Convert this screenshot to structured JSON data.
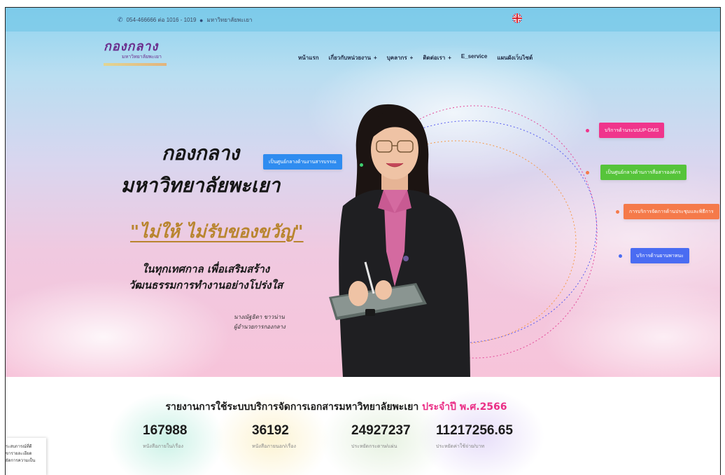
{
  "topbar": {
    "phone": "054-466666 ต่อ 1016 - 1019",
    "location": "มหาวิทยาลัยพะเยา"
  },
  "logo": {
    "title": "กองกลาง",
    "subtitle": "มหาวิทยาลัยพะเยา"
  },
  "nav": {
    "items": [
      {
        "label": "หน้าแรก",
        "plus": ""
      },
      {
        "label": "เกี่ยวกับหน่วยงาน",
        "plus": "+"
      },
      {
        "label": "บุคลากร",
        "plus": "+"
      },
      {
        "label": "ติดต่อเรา",
        "plus": "+"
      },
      {
        "label": "E_service",
        "plus": ""
      },
      {
        "label": "แผนผังเว็บไซต์",
        "plus": ""
      }
    ]
  },
  "hero": {
    "line1": "กองกลาง",
    "line2": "มหาวิทยาลัยพะเยา",
    "slogan": "\"ไม่ให้ ไม่รับของขวัญ\"",
    "sub1": "ในทุกเทศกาล เพื่อเสริมสร้าง",
    "sub2": "วัฒนธรรมการทำงานอย่างโปร่งใส",
    "sign_name": "นางณัฐธิดา ขาวน่าน",
    "sign_title": "ผู้อำนวยการกองกลาง"
  },
  "services": [
    {
      "label": "เป็นศูนย์กลางด้านงานสารบรรณ",
      "color": "#2f8cf0"
    },
    {
      "label": "บริการด้านระบบUP-DMS",
      "color": "#f0358c"
    },
    {
      "label": "เป็นศูนย์กลางด้านการสื่อสารองค์กร",
      "color": "#56c43a"
    },
    {
      "label": "การบริการจัดการด้านประชุมและพิธีการ",
      "color": "#f57a4a"
    },
    {
      "label": "บริการด้านยานพาหนะ",
      "color": "#4a6cf2"
    }
  ],
  "stats": {
    "title": "รายงานการใช้ระบบบริการจัดการเอกสารมหาวิทยาลัยพะเยา",
    "title_highlight": "ประจำปี พ.ศ.2566",
    "items": [
      {
        "value": "167988",
        "label": "หนังสือภายใน/เรื่อง"
      },
      {
        "value": "36192",
        "label": "หนังสือภายนอก/เรื่อง"
      },
      {
        "value": "24927237",
        "label": "ประหยัดกระดาษ/แผ่น"
      },
      {
        "value": "11217256.65",
        "label": "ประหยัดค่าใช้จ่าย/บาท"
      }
    ]
  },
  "popup": {
    "line1": "ระสบการณ์ที่ดี",
    "line2": "ขารายละเอียด",
    "line3": "ยัดการความเป็น"
  }
}
